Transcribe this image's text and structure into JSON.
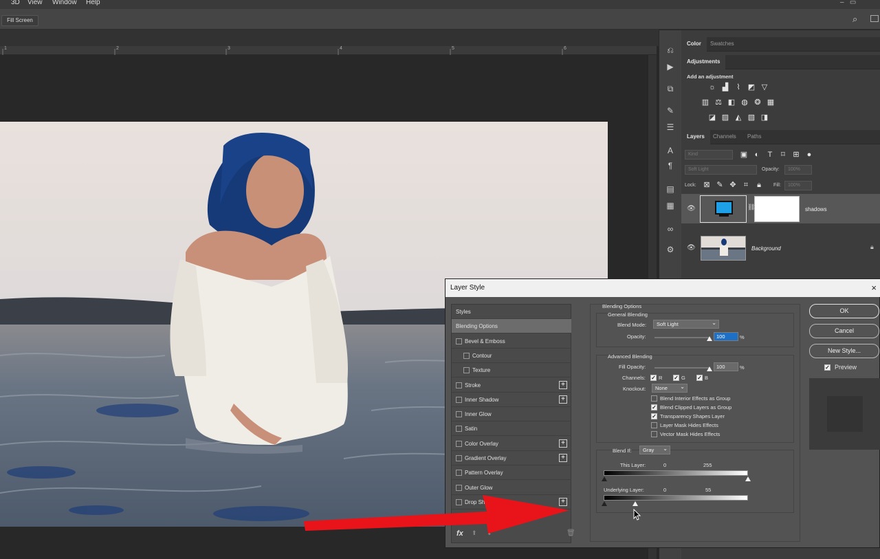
{
  "menu": {
    "items": [
      "3D",
      "View",
      "Window",
      "Help"
    ]
  },
  "options_bar": {
    "fill_screen_label": "Fill Screen"
  },
  "ruler": {
    "ticks": [
      "1",
      "2",
      "3",
      "4",
      "5",
      "6"
    ]
  },
  "right_panel": {
    "top_tabs": [
      "Color",
      "Swatches"
    ],
    "adjustments_tab": "Adjustments",
    "add_adjustment_label": "Add an adjustment",
    "layers_tabs": [
      "Layers",
      "Channels",
      "Paths"
    ],
    "kind_placeholder": "Kind",
    "blend_mode_value": "Soft Light",
    "opacity_label": "Opacity:",
    "opacity_value": "100%",
    "lock_label": "Lock:",
    "fill_label": "Fill:",
    "fill_value": "100%",
    "layers": [
      {
        "name": "shadows"
      },
      {
        "name": "Background"
      }
    ]
  },
  "dialog": {
    "title": "Layer Style",
    "close": "×",
    "styles_list": [
      {
        "label": "Styles",
        "checkbox": false,
        "plus": false,
        "selected": false,
        "indent": 0
      },
      {
        "label": "Blending Options",
        "checkbox": false,
        "plus": false,
        "selected": true,
        "indent": 0
      },
      {
        "label": "Bevel & Emboss",
        "checkbox": true,
        "plus": false,
        "selected": false,
        "indent": 0
      },
      {
        "label": "Contour",
        "checkbox": true,
        "plus": false,
        "selected": false,
        "indent": 1
      },
      {
        "label": "Texture",
        "checkbox": true,
        "plus": false,
        "selected": false,
        "indent": 1
      },
      {
        "label": "Stroke",
        "checkbox": true,
        "plus": true,
        "selected": false,
        "indent": 0
      },
      {
        "label": "Inner Shadow",
        "checkbox": true,
        "plus": true,
        "selected": false,
        "indent": 0
      },
      {
        "label": "Inner Glow",
        "checkbox": true,
        "plus": false,
        "selected": false,
        "indent": 0
      },
      {
        "label": "Satin",
        "checkbox": true,
        "plus": false,
        "selected": false,
        "indent": 0
      },
      {
        "label": "Color Overlay",
        "checkbox": true,
        "plus": true,
        "selected": false,
        "indent": 0
      },
      {
        "label": "Gradient Overlay",
        "checkbox": true,
        "plus": true,
        "selected": false,
        "indent": 0
      },
      {
        "label": "Pattern Overlay",
        "checkbox": true,
        "plus": false,
        "selected": false,
        "indent": 0
      },
      {
        "label": "Outer Glow",
        "checkbox": true,
        "plus": false,
        "selected": false,
        "indent": 0
      },
      {
        "label": "Drop Sh",
        "checkbox": true,
        "plus": true,
        "selected": false,
        "indent": 0
      }
    ],
    "fx_label": "fx",
    "blending_options_title": "Blending Options",
    "general_blending_title": "General Blending",
    "blend_mode_label": "Blend Mode:",
    "blend_mode_value": "Soft Light",
    "opacity_label": "Opacity:",
    "opacity_value": "100",
    "percent": "%",
    "opacity_level": 1.0,
    "advanced_blending_title": "Advanced Blending",
    "fill_opacity_label": "Fill Opacity:",
    "fill_opacity_value": "100",
    "fill_opacity_level": 1.0,
    "channels_label": "Channels:",
    "channels": [
      "R",
      "G",
      "B"
    ],
    "knockout_label": "Knockout:",
    "knockout_value": "None",
    "options": [
      {
        "label": "Blend Interior Effects as Group",
        "checked": false
      },
      {
        "label": "Blend Clipped Layers as Group",
        "checked": true
      },
      {
        "label": "Transparency Shapes Layer",
        "checked": true
      },
      {
        "label": "Layer Mask Hides Effects",
        "checked": false
      },
      {
        "label": "Vector Mask Hides Effects",
        "checked": false
      }
    ],
    "blend_if_label": "Blend If:",
    "blend_if_value": "Gray",
    "this_layer_label": "This Layer:",
    "this_layer_low": "0",
    "this_layer_high": "255",
    "underlying_label": "Underlying Layer:",
    "underlying_low": "0",
    "underlying_high": "55",
    "buttons": {
      "ok": "OK",
      "cancel": "Cancel",
      "new_style": "New Style...",
      "preview": "Preview"
    }
  },
  "colors": {
    "accent_blue": "#1ea0e6",
    "arrow_red": "#e8141a",
    "dialog_bg": "#535353"
  }
}
